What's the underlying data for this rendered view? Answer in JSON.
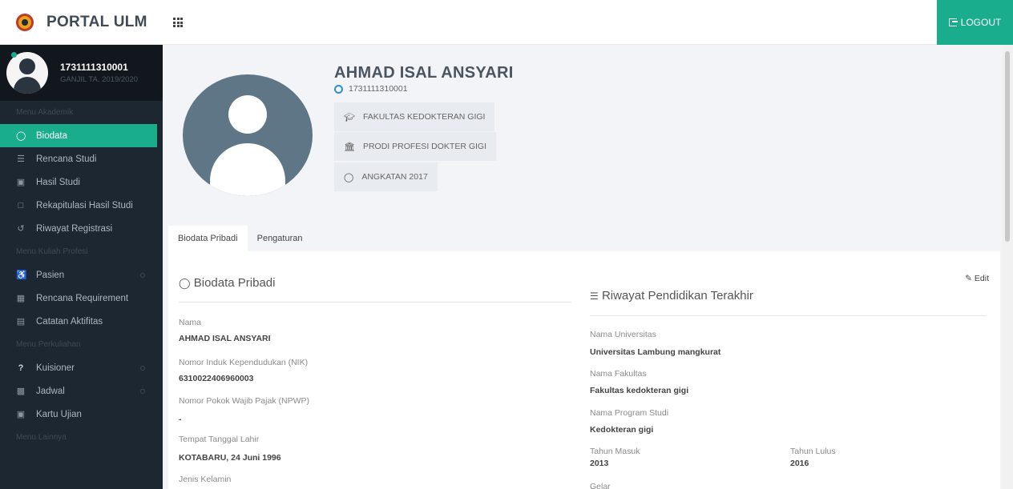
{
  "brand": {
    "name": "PORTAL ULM"
  },
  "topbar": {
    "logout_label": "LOGOUT"
  },
  "sidebar": {
    "profile": {
      "id": "1731111310001",
      "semester": "GANJIL TA. 2019/2020"
    },
    "sections": {
      "akademik": "Menu Akademik",
      "profesi": "Menu Kuliah Profesi",
      "perkuliahan": "Menu Perkuliahan",
      "lainnya": "Menu Lainnya"
    },
    "items": {
      "biodata": {
        "label": "Biodata",
        "icon": "user-icon"
      },
      "rencana_studi": {
        "label": "Rencana Studi",
        "icon": "mortarboard-icon"
      },
      "hasil_studi": {
        "label": "Hasil Studi",
        "icon": "chart-icon"
      },
      "rekapitulasi": {
        "label": "Rekapitulasi Hasil Studi",
        "icon": "clipboard-icon"
      },
      "riwayat": {
        "label": "Riwayat Registrasi",
        "icon": "history-icon"
      },
      "pasien": {
        "label": "Pasien",
        "icon": "wheelchair-icon"
      },
      "rencana_requirement": {
        "label": "Rencana Requirement",
        "icon": "calendar-icon"
      },
      "catatan": {
        "label": "Catatan Aktifitas",
        "icon": "book-icon"
      },
      "kuisioner": {
        "label": "Kuisioner",
        "icon": "question-icon"
      },
      "jadwal": {
        "label": "Jadwal",
        "icon": "calendar-icon"
      },
      "kartu_ujian": {
        "label": "Kartu Ujian",
        "icon": "card-icon"
      }
    }
  },
  "header": {
    "name": "AHMAD ISAL ANSYARI",
    "nim": "1731111310001",
    "faculty": "FAKULTAS KEDOKTERAN GIGI",
    "program": "PRODI PROFESI DOKTER GIGI",
    "angkatan": "ANGKATAN 2017"
  },
  "tabs": {
    "biodata": "Biodata Pribadi",
    "pengaturan": "Pengaturan"
  },
  "edit_label": "Edit",
  "biodata": {
    "title": "Biodata Pribadi",
    "nama_label": "Nama",
    "nama_value": "AHMAD ISAL ANSYARI",
    "nik_label": "Nomor Induk Kependudukan (NIK)",
    "nik_value": "6310022406960003",
    "npwp_label": "Nomor Pokok Wajib Pajak (NPWP)",
    "npwp_value": "-",
    "ttl_label": "Tempat Tanggal Lahir",
    "ttl_value": "KOTABARU, 24 Juni 1996",
    "jk_label": "Jenis Kelamin"
  },
  "pendidikan": {
    "title": "Riwayat Pendidikan Terakhir",
    "univ_label": "Nama Universitas",
    "univ_value": "Universitas Lambung mangkurat",
    "fak_label": "Nama Fakultas",
    "fak_value": "Fakultas kedokteran gigi",
    "prodi_label": "Nama Program Studi",
    "prodi_value": "Kedokteran gigi",
    "masuk_label": "Tahun Masuk",
    "masuk_value": "2013",
    "lulus_label": "Tahun Lulus",
    "lulus_value": "2016",
    "gelar_label": "Gelar"
  }
}
